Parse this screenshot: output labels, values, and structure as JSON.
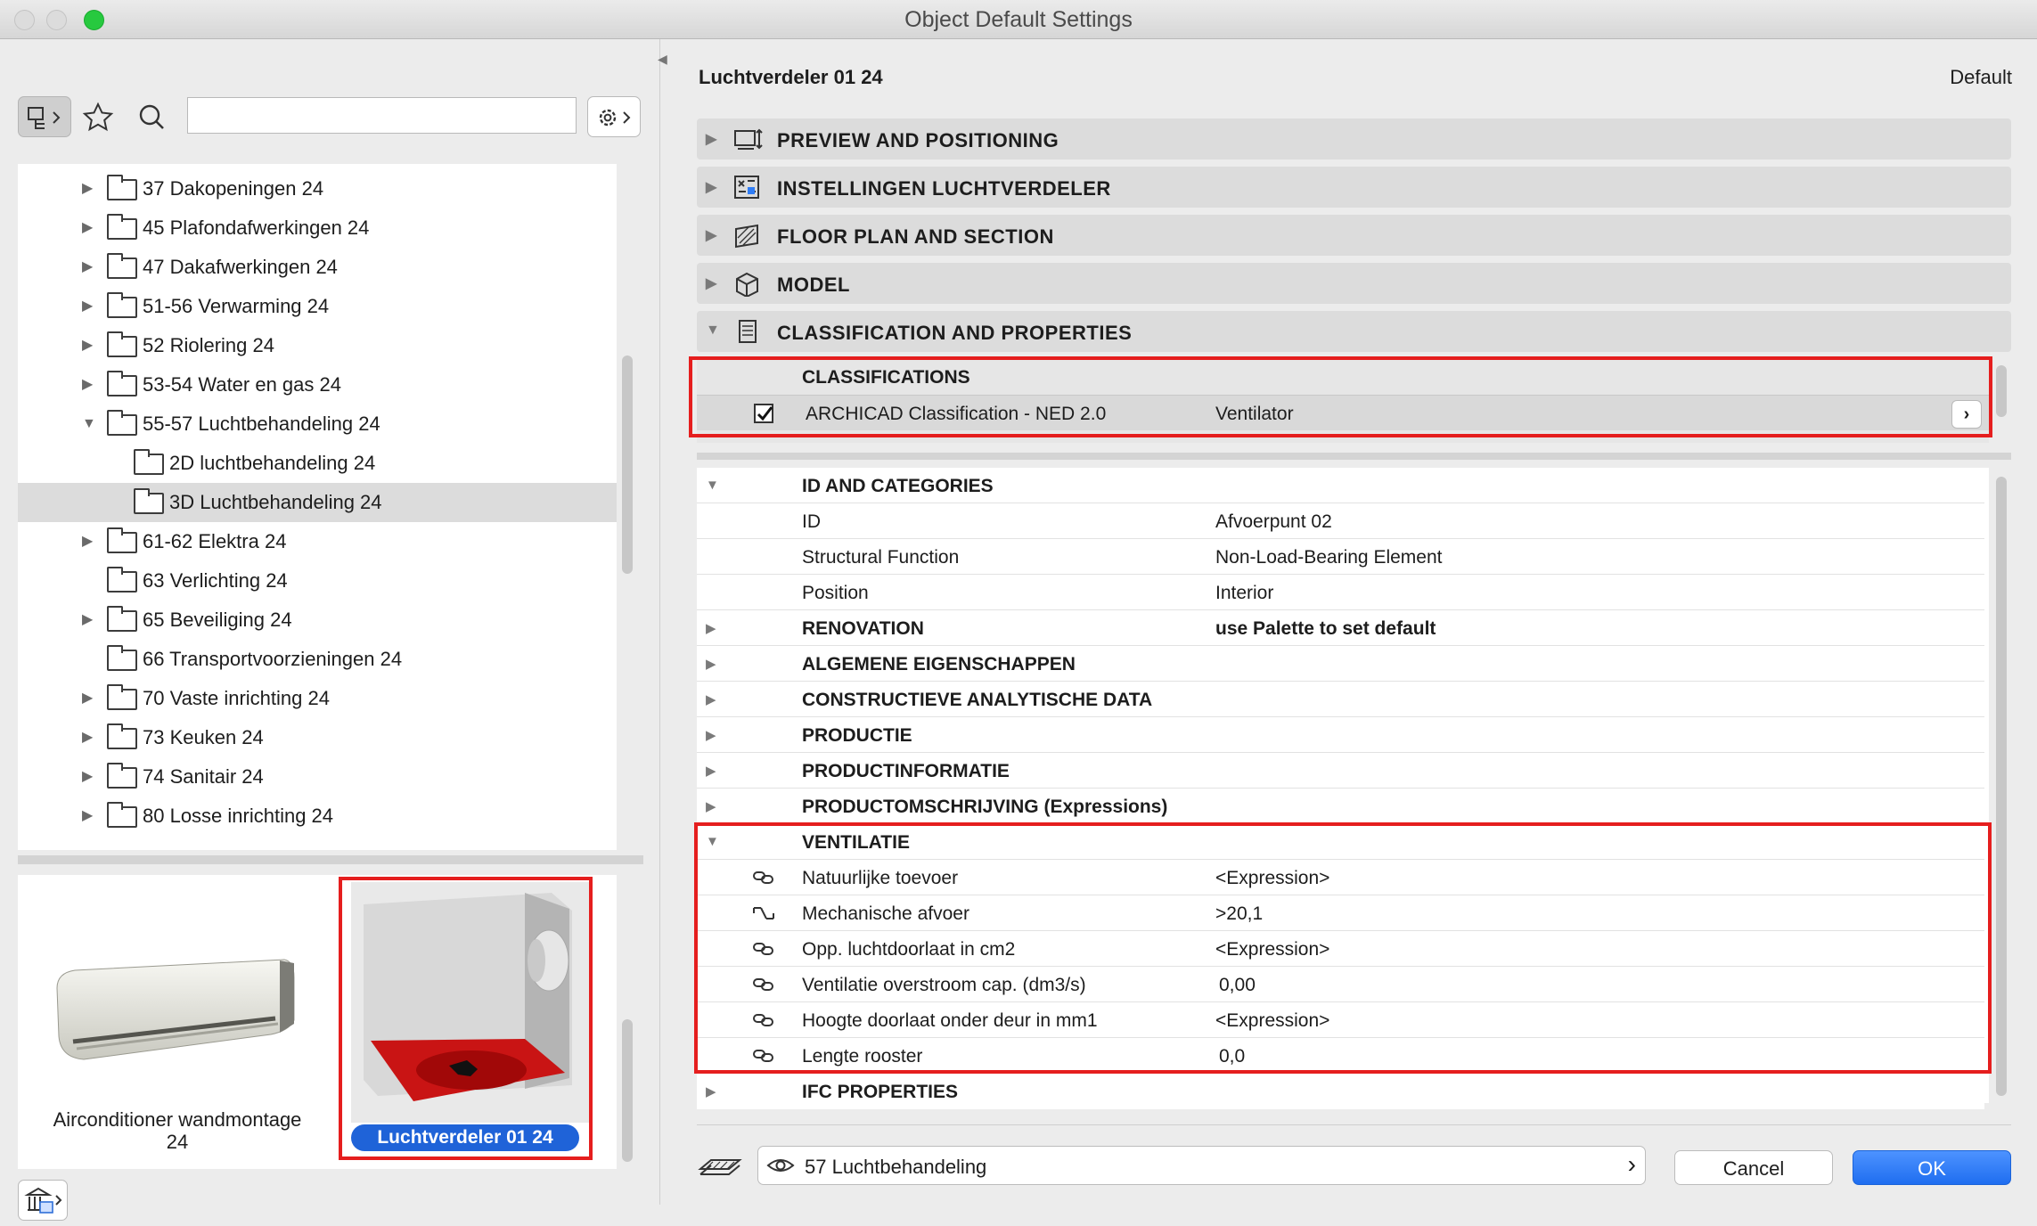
{
  "window": {
    "title": "Object Default Settings"
  },
  "left": {
    "search_value": "",
    "tree": [
      {
        "label": "37 Dakopeningen 24",
        "disclosure": "collapsed"
      },
      {
        "label": "45 Plafondafwerkingen 24",
        "disclosure": "collapsed"
      },
      {
        "label": "47 Dakafwerkingen 24",
        "disclosure": "collapsed"
      },
      {
        "label": "51-56 Verwarming 24",
        "disclosure": "collapsed"
      },
      {
        "label": "52 Riolering 24",
        "disclosure": "collapsed"
      },
      {
        "label": "53-54 Water en gas 24",
        "disclosure": "collapsed"
      },
      {
        "label": "55-57 Luchtbehandeling 24",
        "disclosure": "expanded"
      },
      {
        "label": "2D luchtbehandeling 24",
        "disclosure": "none"
      },
      {
        "label": "3D Luchtbehandeling 24",
        "disclosure": "none",
        "selected": true
      },
      {
        "label": "61-62 Elektra 24",
        "disclosure": "collapsed"
      },
      {
        "label": "63 Verlichting 24",
        "disclosure": "none"
      },
      {
        "label": "65 Beveiliging 24",
        "disclosure": "collapsed"
      },
      {
        "label": "66 Transportvoorzieningen 24",
        "disclosure": "none"
      },
      {
        "label": "70 Vaste inrichting 24",
        "disclosure": "collapsed"
      },
      {
        "label": "73 Keuken 24",
        "disclosure": "collapsed"
      },
      {
        "label": "74 Sanitair 24",
        "disclosure": "collapsed"
      },
      {
        "label": "80 Losse inrichting 24",
        "disclosure": "collapsed"
      }
    ],
    "gallery": {
      "item1_line1": "Airconditioner wandmontage",
      "item1_line2": "24",
      "item2": "Luchtverdeler 01 24"
    }
  },
  "right": {
    "object_name": "Luchtverdeler 01 24",
    "default_label": "Default",
    "sections": {
      "preview": "PREVIEW AND POSITIONING",
      "instellingen": "INSTELLINGEN LUCHTVERDELER",
      "floorplan": "FLOOR PLAN AND SECTION",
      "model": "MODEL",
      "classprops": "CLASSIFICATION AND PROPERTIES"
    },
    "classifications": {
      "title": "CLASSIFICATIONS",
      "system": "ARCHICAD Classification - NED 2.0",
      "value": "Ventilator"
    },
    "id_group": {
      "title": "ID AND CATEGORIES",
      "rows": [
        {
          "name": "ID",
          "value": "Afvoerpunt 02"
        },
        {
          "name": "Structural Function",
          "value": "Non-Load-Bearing Element"
        },
        {
          "name": "Position",
          "value": "Interior"
        }
      ]
    },
    "renovation": {
      "name": "RENOVATION",
      "value": "use Palette to set default"
    },
    "groups": [
      "ALGEMENE EIGENSCHAPPEN",
      "CONSTRUCTIEVE ANALYTISCHE DATA",
      "PRODUCTIE",
      "PRODUCTINFORMATIE",
      "PRODUCTOMSCHRIJVING (Expressions)"
    ],
    "ventilatie": {
      "title": "VENTILATIE",
      "rows": [
        {
          "name": "Natuurlijke toevoer",
          "value": "<Expression>"
        },
        {
          "name": "Mechanische afvoer",
          "value": ">20,1"
        },
        {
          "name": "Opp. luchtdoorlaat in cm2",
          "value": "<Expression>"
        },
        {
          "name": "Ventilatie overstroom cap. (dm3/s)",
          "value": "0,00"
        },
        {
          "name": "Hoogte doorlaat onder deur in mm1",
          "value": "<Expression>"
        },
        {
          "name": "Lengte rooster",
          "value": "0,0"
        }
      ]
    },
    "ifc": "IFC PROPERTIES",
    "layer": "57 Luchtbehandeling",
    "cancel": "Cancel",
    "ok": "OK"
  },
  "colors": {
    "accent": "#2f7df6",
    "highlight": "#e51e1e",
    "selection_badge": "#1f63d8"
  }
}
